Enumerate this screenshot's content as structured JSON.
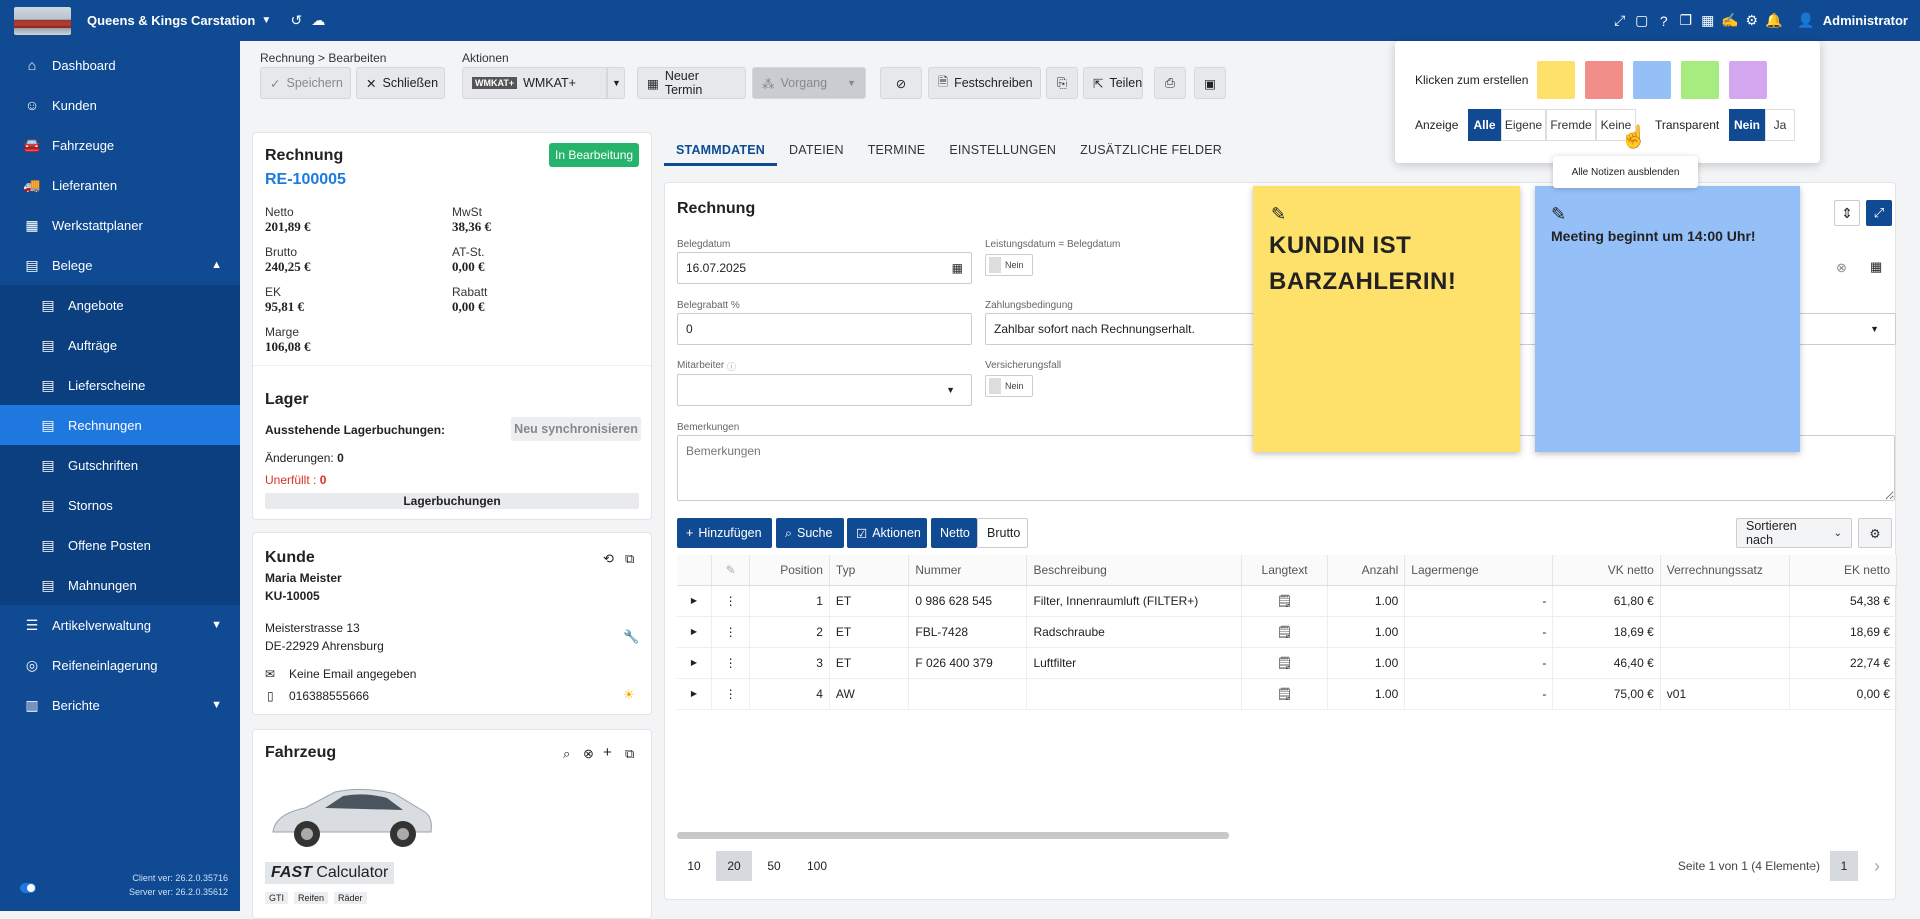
{
  "app": {
    "company": "Queens & Kings Carstation",
    "user": "Administrator"
  },
  "sidebar": {
    "items": [
      {
        "label": "Dashboard",
        "icon": "home-icon"
      },
      {
        "label": "Kunden",
        "icon": "user-icon"
      },
      {
        "label": "Fahrzeuge",
        "icon": "car-icon"
      },
      {
        "label": "Lieferanten",
        "icon": "truck-icon"
      },
      {
        "label": "Werkstattplaner",
        "icon": "calendar-icon"
      },
      {
        "label": "Belege",
        "icon": "document-icon"
      },
      {
        "label": "Angebote",
        "icon": "document-icon"
      },
      {
        "label": "Aufträge",
        "icon": "document-icon"
      },
      {
        "label": "Lieferscheine",
        "icon": "delivery-icon"
      },
      {
        "label": "Rechnungen",
        "icon": "document-icon"
      },
      {
        "label": "Gutschriften",
        "icon": "document-icon"
      },
      {
        "label": "Stornos",
        "icon": "document-icon"
      },
      {
        "label": "Offene Posten",
        "icon": "document-icon"
      },
      {
        "label": "Mahnungen",
        "icon": "document-icon"
      },
      {
        "label": "Artikelverwaltung",
        "icon": "list-icon"
      },
      {
        "label": "Reifeneinlagerung",
        "icon": "tire-icon"
      },
      {
        "label": "Berichte",
        "icon": "chart-icon"
      }
    ],
    "client_ver": "Client ver: 26.2.0.35716",
    "server_ver": "Server ver: 26.2.0.35612"
  },
  "toolbar": {
    "breadcrumb": "Rechnung > Bearbeiten",
    "actions_label": "Aktionen",
    "save": "Speichern",
    "close": "Schließen",
    "wmkat_logo": "WMKAT+",
    "wmkat": "WMKAT+",
    "new_appt": "Neuer Termin",
    "vorgang": "Vorgang",
    "festschreiben": "Festschreiben",
    "teilen": "Teilen"
  },
  "invoice": {
    "title": "Rechnung",
    "status": "In Bearbeitung",
    "number": "RE-100005",
    "netto_l": "Netto",
    "netto": "201,89 €",
    "mwst_l": "MwSt",
    "mwst": "38,36 €",
    "brutto_l": "Brutto",
    "brutto": "240,25 €",
    "atst_l": "AT-St.",
    "atst": "0,00 €",
    "ek_l": "EK",
    "ek": "95,81 €",
    "rabatt_l": "Rabatt",
    "rabatt": "0,00 €",
    "marge_l": "Marge",
    "marge": "106,08 €"
  },
  "lager": {
    "title": "Lager",
    "pending": "Ausstehende Lagerbuchungen:",
    "sync": "Neu synchronisieren",
    "changes_l": "Änderungen:",
    "changes": "0",
    "unfilled_l": "Unerfüllt :",
    "unfilled": "0",
    "bookings": "Lagerbuchungen"
  },
  "kunde": {
    "title": "Kunde",
    "name": "Maria Meister",
    "id": "KU-10005",
    "street": "Meisterstrasse 13",
    "city": "DE-22929 Ahrensburg",
    "email": "Keine Email angegeben",
    "phone": "016388555666"
  },
  "fahrzeug": {
    "title": "Fahrzeug",
    "calc_brand": "FAST",
    "calc_name": "Calculator",
    "tag1": "GTI",
    "tag2": "Reifen",
    "tag3": "Räder"
  },
  "tabs": [
    "STAMMDATEN",
    "DATEIEN",
    "TERMINE",
    "EINSTELLUNGEN",
    "ZUSÄTZLICHE FELDER"
  ],
  "form": {
    "title": "Rechnung",
    "belegdatum_l": "Belegdatum",
    "belegdatum": "16.07.2025",
    "leistung_l": "Leistungsdatum = Belegdatum",
    "nein": "Nein",
    "rabatt_l": "Belegrabatt %",
    "rabatt": "0",
    "zahlung_l": "Zahlungsbedingung",
    "zahlung": "Zahlbar sofort nach Rechnungserhalt.",
    "mitarbeiter_l": "Mitarbeiter",
    "versicherung_l": "Versicherungsfall",
    "bemerkungen_l": "Bemerkungen",
    "bemerkungen_ph": "Bemerkungen"
  },
  "grid": {
    "add": "Hinzufügen",
    "search": "Suche",
    "actions": "Aktionen",
    "netto": "Netto",
    "brutto": "Brutto",
    "sort": "Sortieren nach",
    "headers": [
      "",
      "",
      "Position",
      "Typ",
      "Nummer",
      "Beschreibung",
      "Langtext",
      "Anzahl",
      "Lagermenge",
      "VK netto",
      "Verrechnungssatz",
      "EK netto"
    ],
    "rows": [
      {
        "pos": "1",
        "typ": "ET",
        "nr": "0 986 628 545",
        "desc": "Filter, Innenraumluft (FILTER+)",
        "anz": "1.00",
        "lager": "-",
        "vk": "61,80 €",
        "vs": "",
        "ek": "54,38 €"
      },
      {
        "pos": "2",
        "typ": "ET",
        "nr": "FBL-7428",
        "desc": "Radschraube",
        "anz": "1.00",
        "lager": "-",
        "vk": "18,69 €",
        "vs": "",
        "ek": "18,69 €"
      },
      {
        "pos": "3",
        "typ": "ET",
        "nr": "F 026 400 379",
        "desc": "Luftfilter",
        "anz": "1.00",
        "lager": "-",
        "vk": "46,40 €",
        "vs": "",
        "ek": "22,74 €"
      },
      {
        "pos": "4",
        "typ": "AW",
        "nr": "",
        "desc": "",
        "anz": "1.00",
        "lager": "-",
        "vk": "75,00 €",
        "vs": "v01",
        "ek": "0,00 €"
      }
    ],
    "page_sizes": [
      "10",
      "20",
      "50",
      "100"
    ],
    "page_info": "Seite 1 von 1 (4 Elemente)",
    "page": "1"
  },
  "notes": [
    {
      "text": "KUNDIN IST BARZAHLERIN!",
      "color": "#fde16a"
    },
    {
      "text": "Meeting beginnt um 14:00 Uhr!",
      "color": "#95c0f7"
    }
  ],
  "popup": {
    "create_label": "Klicken zum erstellen",
    "colors": [
      "#fde16a",
      "#f28e8a",
      "#95c0f7",
      "#a6ec7f",
      "#d3a6f0"
    ],
    "anzeige": "Anzeige",
    "filters": [
      "Alle",
      "Eigene",
      "Fremde",
      "Keine"
    ],
    "transparent": "Transparent",
    "nein": "Nein",
    "ja": "Ja",
    "tooltip": "Alle Notizen ausblenden"
  }
}
